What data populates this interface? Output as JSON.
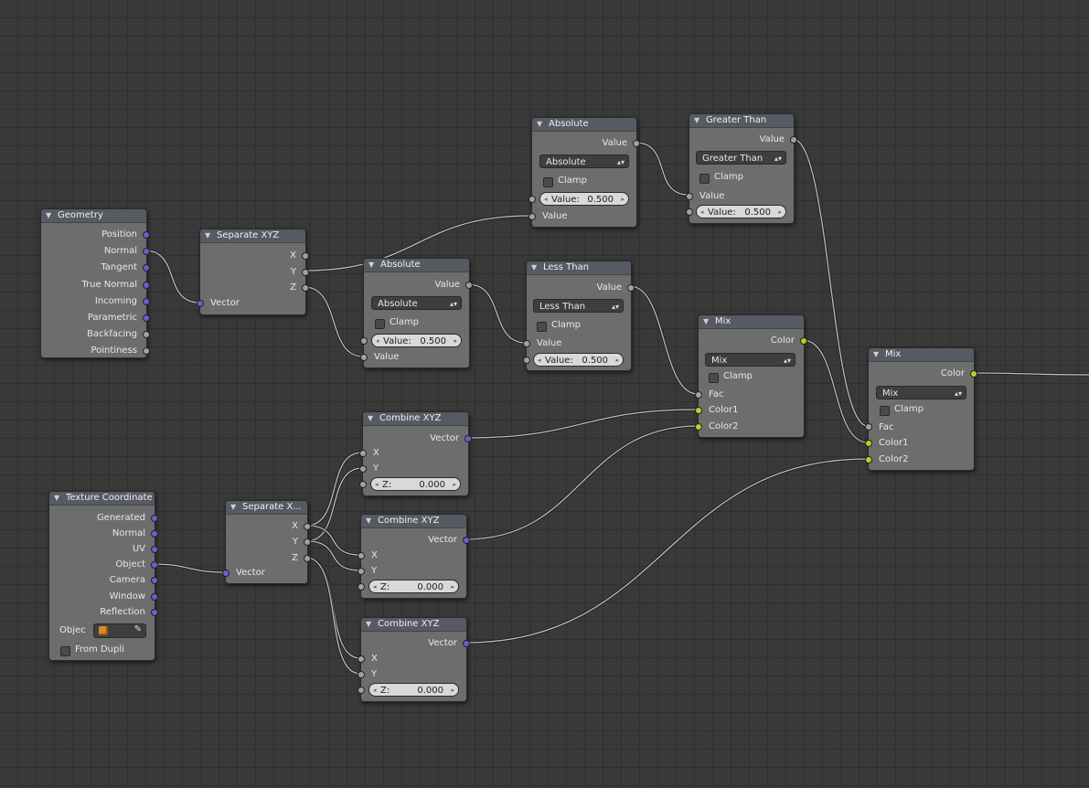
{
  "icons": {
    "collapse": "▼",
    "dropdown": "▴▾",
    "left": "◂",
    "right": "▸",
    "eyedropper": "✎"
  },
  "colors": {
    "vector_socket": "#6363c7",
    "float_socket": "#a1a1a1",
    "color_socket": "#c7c729",
    "link": "#bdbdbd"
  },
  "geometry": {
    "title": "Geometry",
    "outputs": [
      "Position",
      "Normal",
      "Tangent",
      "True Normal",
      "Incoming",
      "Parametric",
      "Backfacing",
      "Pointiness"
    ]
  },
  "sep1": {
    "title": "Separate XYZ",
    "outputs": [
      "X",
      "Y",
      "Z"
    ],
    "input": "Vector"
  },
  "abs1": {
    "title": "Absolute",
    "output": "Value",
    "op": "Absolute",
    "clamp": "Clamp",
    "val_label": "Value:",
    "val": "0.500",
    "input2": "Value"
  },
  "abs2": {
    "title": "Absolute",
    "output": "Value",
    "op": "Absolute",
    "clamp": "Clamp",
    "val_label": "Value:",
    "val": "0.500",
    "input1": "Value"
  },
  "gt": {
    "title": "Greater Than",
    "output": "Value",
    "op": "Greater Than",
    "clamp": "Clamp",
    "input1": "Value",
    "val_label": "Value:",
    "val": "0.500"
  },
  "lt": {
    "title": "Less Than",
    "output": "Value",
    "op": "Less Than",
    "clamp": "Clamp",
    "input1": "Value",
    "val_label": "Value:",
    "val": "0.500"
  },
  "mix1": {
    "title": "Mix",
    "output": "Color",
    "op": "Mix",
    "clamp": "Clamp",
    "inputs": [
      "Fac",
      "Color1",
      "Color2"
    ]
  },
  "mix2": {
    "title": "Mix",
    "output": "Color",
    "op": "Mix",
    "clamp": "Clamp",
    "inputs": [
      "Fac",
      "Color1",
      "Color2"
    ]
  },
  "tex": {
    "title": "Texture Coordinate",
    "outputs": [
      "Generated",
      "Normal",
      "UV",
      "Object",
      "Camera",
      "Window",
      "Reflection"
    ],
    "object_label": "Objec",
    "from_dupli": "From Dupli"
  },
  "sep2": {
    "title": "Separate X...",
    "outputs": [
      "X",
      "Y",
      "Z"
    ],
    "input": "Vector"
  },
  "comb1": {
    "title": "Combine XYZ",
    "output": "Vector",
    "inputs": [
      "X",
      "Y"
    ],
    "z_label": "Z:",
    "z": "0.000"
  },
  "comb2": {
    "title": "Combine XYZ",
    "output": "Vector",
    "inputs": [
      "X",
      "Y"
    ],
    "z_label": "Z:",
    "z": "0.000"
  },
  "comb3": {
    "title": "Combine XYZ",
    "output": "Vector",
    "inputs": [
      "X",
      "Y"
    ],
    "z_label": "Z:",
    "z": "0.000"
  }
}
